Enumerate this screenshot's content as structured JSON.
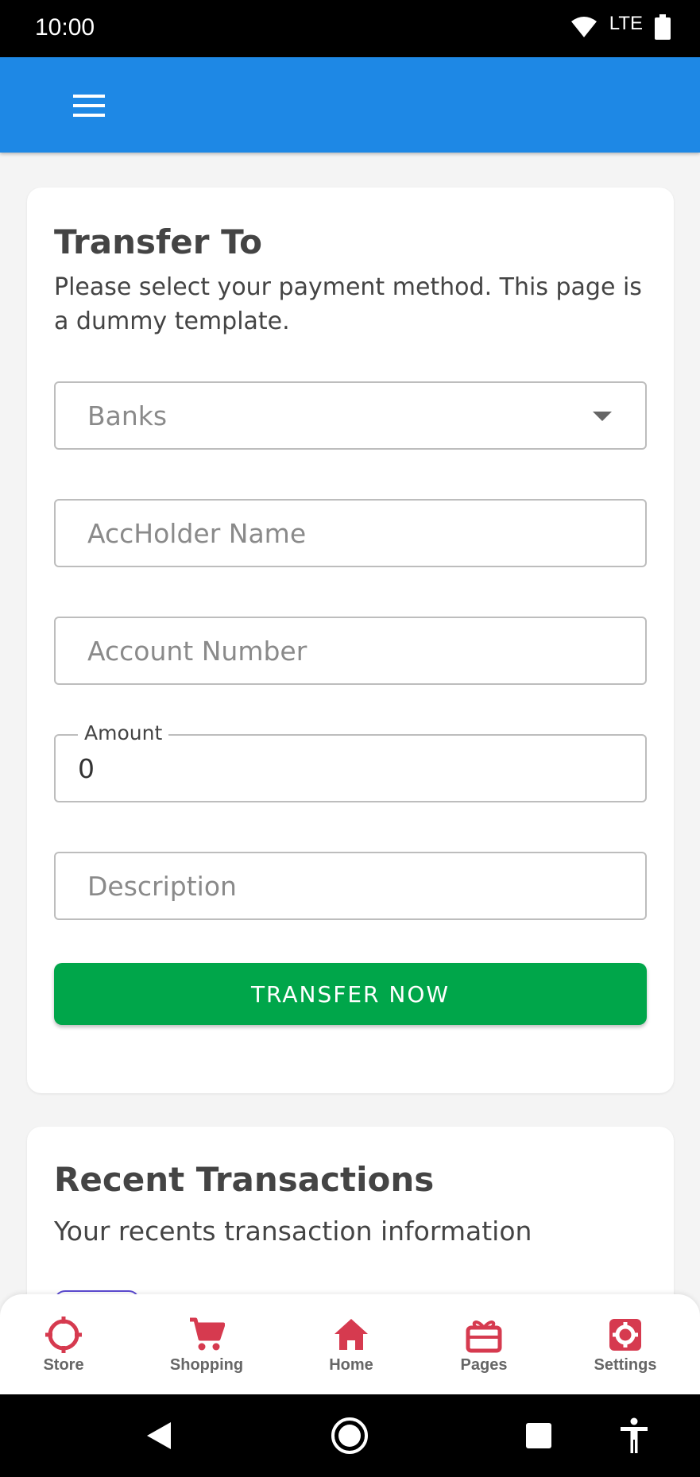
{
  "status_bar": {
    "time": "10:00",
    "network": "LTE",
    "icons": [
      "wifi-icon",
      "lte-signal-icon",
      "battery-icon"
    ]
  },
  "app_bar": {
    "menu_icon": "hamburger-menu-icon",
    "background_color": "#1e88e5"
  },
  "transfer_card": {
    "title": "Transfer To",
    "subtitle": "Please select your payment method. This page is a dummy template.",
    "bank_select": {
      "placeholder": "Banks",
      "icon": "chevron-down-icon"
    },
    "account_holder": {
      "placeholder": "AccHolder Name",
      "value": ""
    },
    "account_number": {
      "placeholder": "Account Number",
      "value": ""
    },
    "amount": {
      "label": "Amount",
      "value": "0"
    },
    "description": {
      "placeholder": "Description",
      "value": ""
    },
    "submit_label": "TRANSFER NOW",
    "submit_color": "#00a64a"
  },
  "recent_card": {
    "title": "Recent Transactions",
    "subtitle": "Your recents transaction information"
  },
  "bottom_nav": {
    "accent_color": "#d63a4f",
    "items": [
      {
        "label": "Store",
        "icon": "crosshair-icon"
      },
      {
        "label": "Shopping",
        "icon": "cart-icon"
      },
      {
        "label": "Home",
        "icon": "home-icon"
      },
      {
        "label": "Pages",
        "icon": "gift-icon"
      },
      {
        "label": "Settings",
        "icon": "gear-icon"
      }
    ]
  },
  "system_nav": {
    "buttons": [
      "back-icon",
      "home-circle-icon",
      "recents-square-icon",
      "accessibility-icon"
    ]
  }
}
